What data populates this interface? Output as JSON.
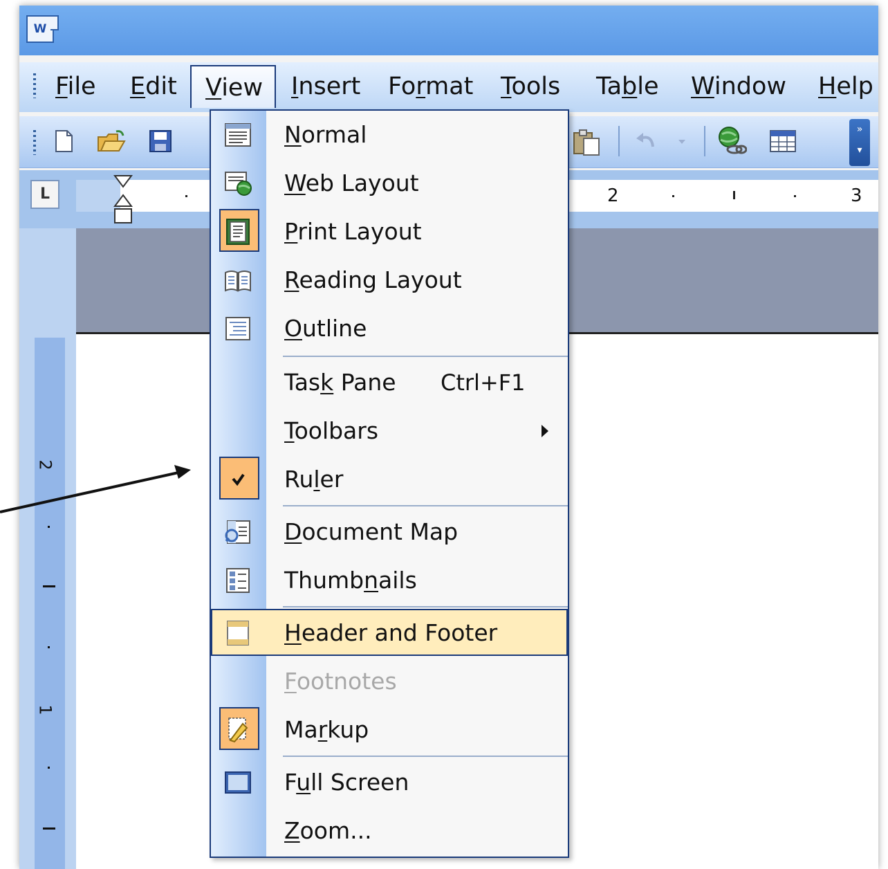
{
  "title_bar": {
    "app_icon": "word-document-icon",
    "app_icon_text": "W"
  },
  "menubar": {
    "items": [
      {
        "label": "File",
        "mnemonic_index": 0
      },
      {
        "label": "Edit",
        "mnemonic_index": 0
      },
      {
        "label": "View",
        "mnemonic_index": 0,
        "active": true
      },
      {
        "label": "Insert",
        "mnemonic_index": 0
      },
      {
        "label": "Format",
        "mnemonic_index": 2
      },
      {
        "label": "Tools",
        "mnemonic_index": 0
      },
      {
        "label": "Table",
        "mnemonic_index": 2
      },
      {
        "label": "Window",
        "mnemonic_index": 0
      },
      {
        "label": "Help",
        "mnemonic_index": 0
      }
    ]
  },
  "toolbar": {
    "buttons": [
      "new-document-icon",
      "open-folder-icon",
      "save-icon",
      "paste-icon",
      "undo-icon",
      "undo-dropdown-icon",
      "insert-hyperlink-icon",
      "insert-table-icon",
      "toolbar-options-icon"
    ]
  },
  "ruler": {
    "tab_selector": "L",
    "numbers": [
      "2",
      "3"
    ],
    "vertical_numbers": [
      "2",
      "1"
    ]
  },
  "view_menu": {
    "items": [
      {
        "label": "Normal",
        "mnemonic_index": 0,
        "icon": "normal-view-icon"
      },
      {
        "label": "Web Layout",
        "mnemonic_index": 0,
        "icon": "web-layout-icon"
      },
      {
        "label": "Print Layout",
        "mnemonic_index": 0,
        "icon": "print-layout-icon",
        "checked": true
      },
      {
        "label": "Reading Layout",
        "mnemonic_index": 0,
        "icon": "reading-layout-icon"
      },
      {
        "label": "Outline",
        "mnemonic_index": 0,
        "icon": "outline-icon"
      },
      {
        "label": "Task Pane",
        "mnemonic_index": 3,
        "shortcut": "Ctrl+F1"
      },
      {
        "label": "Toolbars",
        "mnemonic_index": 0,
        "submenu": true
      },
      {
        "label": "Ruler",
        "mnemonic_index": 2,
        "icon": "checkmark-icon",
        "checked": true
      },
      {
        "label": "Document Map",
        "mnemonic_index": 0,
        "icon": "document-map-icon"
      },
      {
        "label": "Thumbnails",
        "mnemonic_index": 5,
        "icon": "thumbnails-icon"
      },
      {
        "label": "Header and Footer",
        "mnemonic_index": 0,
        "icon": "header-footer-icon",
        "highlighted": true
      },
      {
        "label": "Footnotes",
        "mnemonic_index": 0,
        "disabled": true
      },
      {
        "label": "Markup",
        "mnemonic_index": 2,
        "icon": "markup-icon",
        "checked": true
      },
      {
        "label": "Full Screen",
        "mnemonic_index": 1,
        "icon": "full-screen-icon"
      },
      {
        "label": "Zoom...",
        "mnemonic_index": 0
      }
    ]
  },
  "colors": {
    "titlebar": "#5b99e6",
    "menu_highlight": "#ffedbc",
    "checked_background": "#fbbd76",
    "menu_border": "#1a3a7a"
  }
}
